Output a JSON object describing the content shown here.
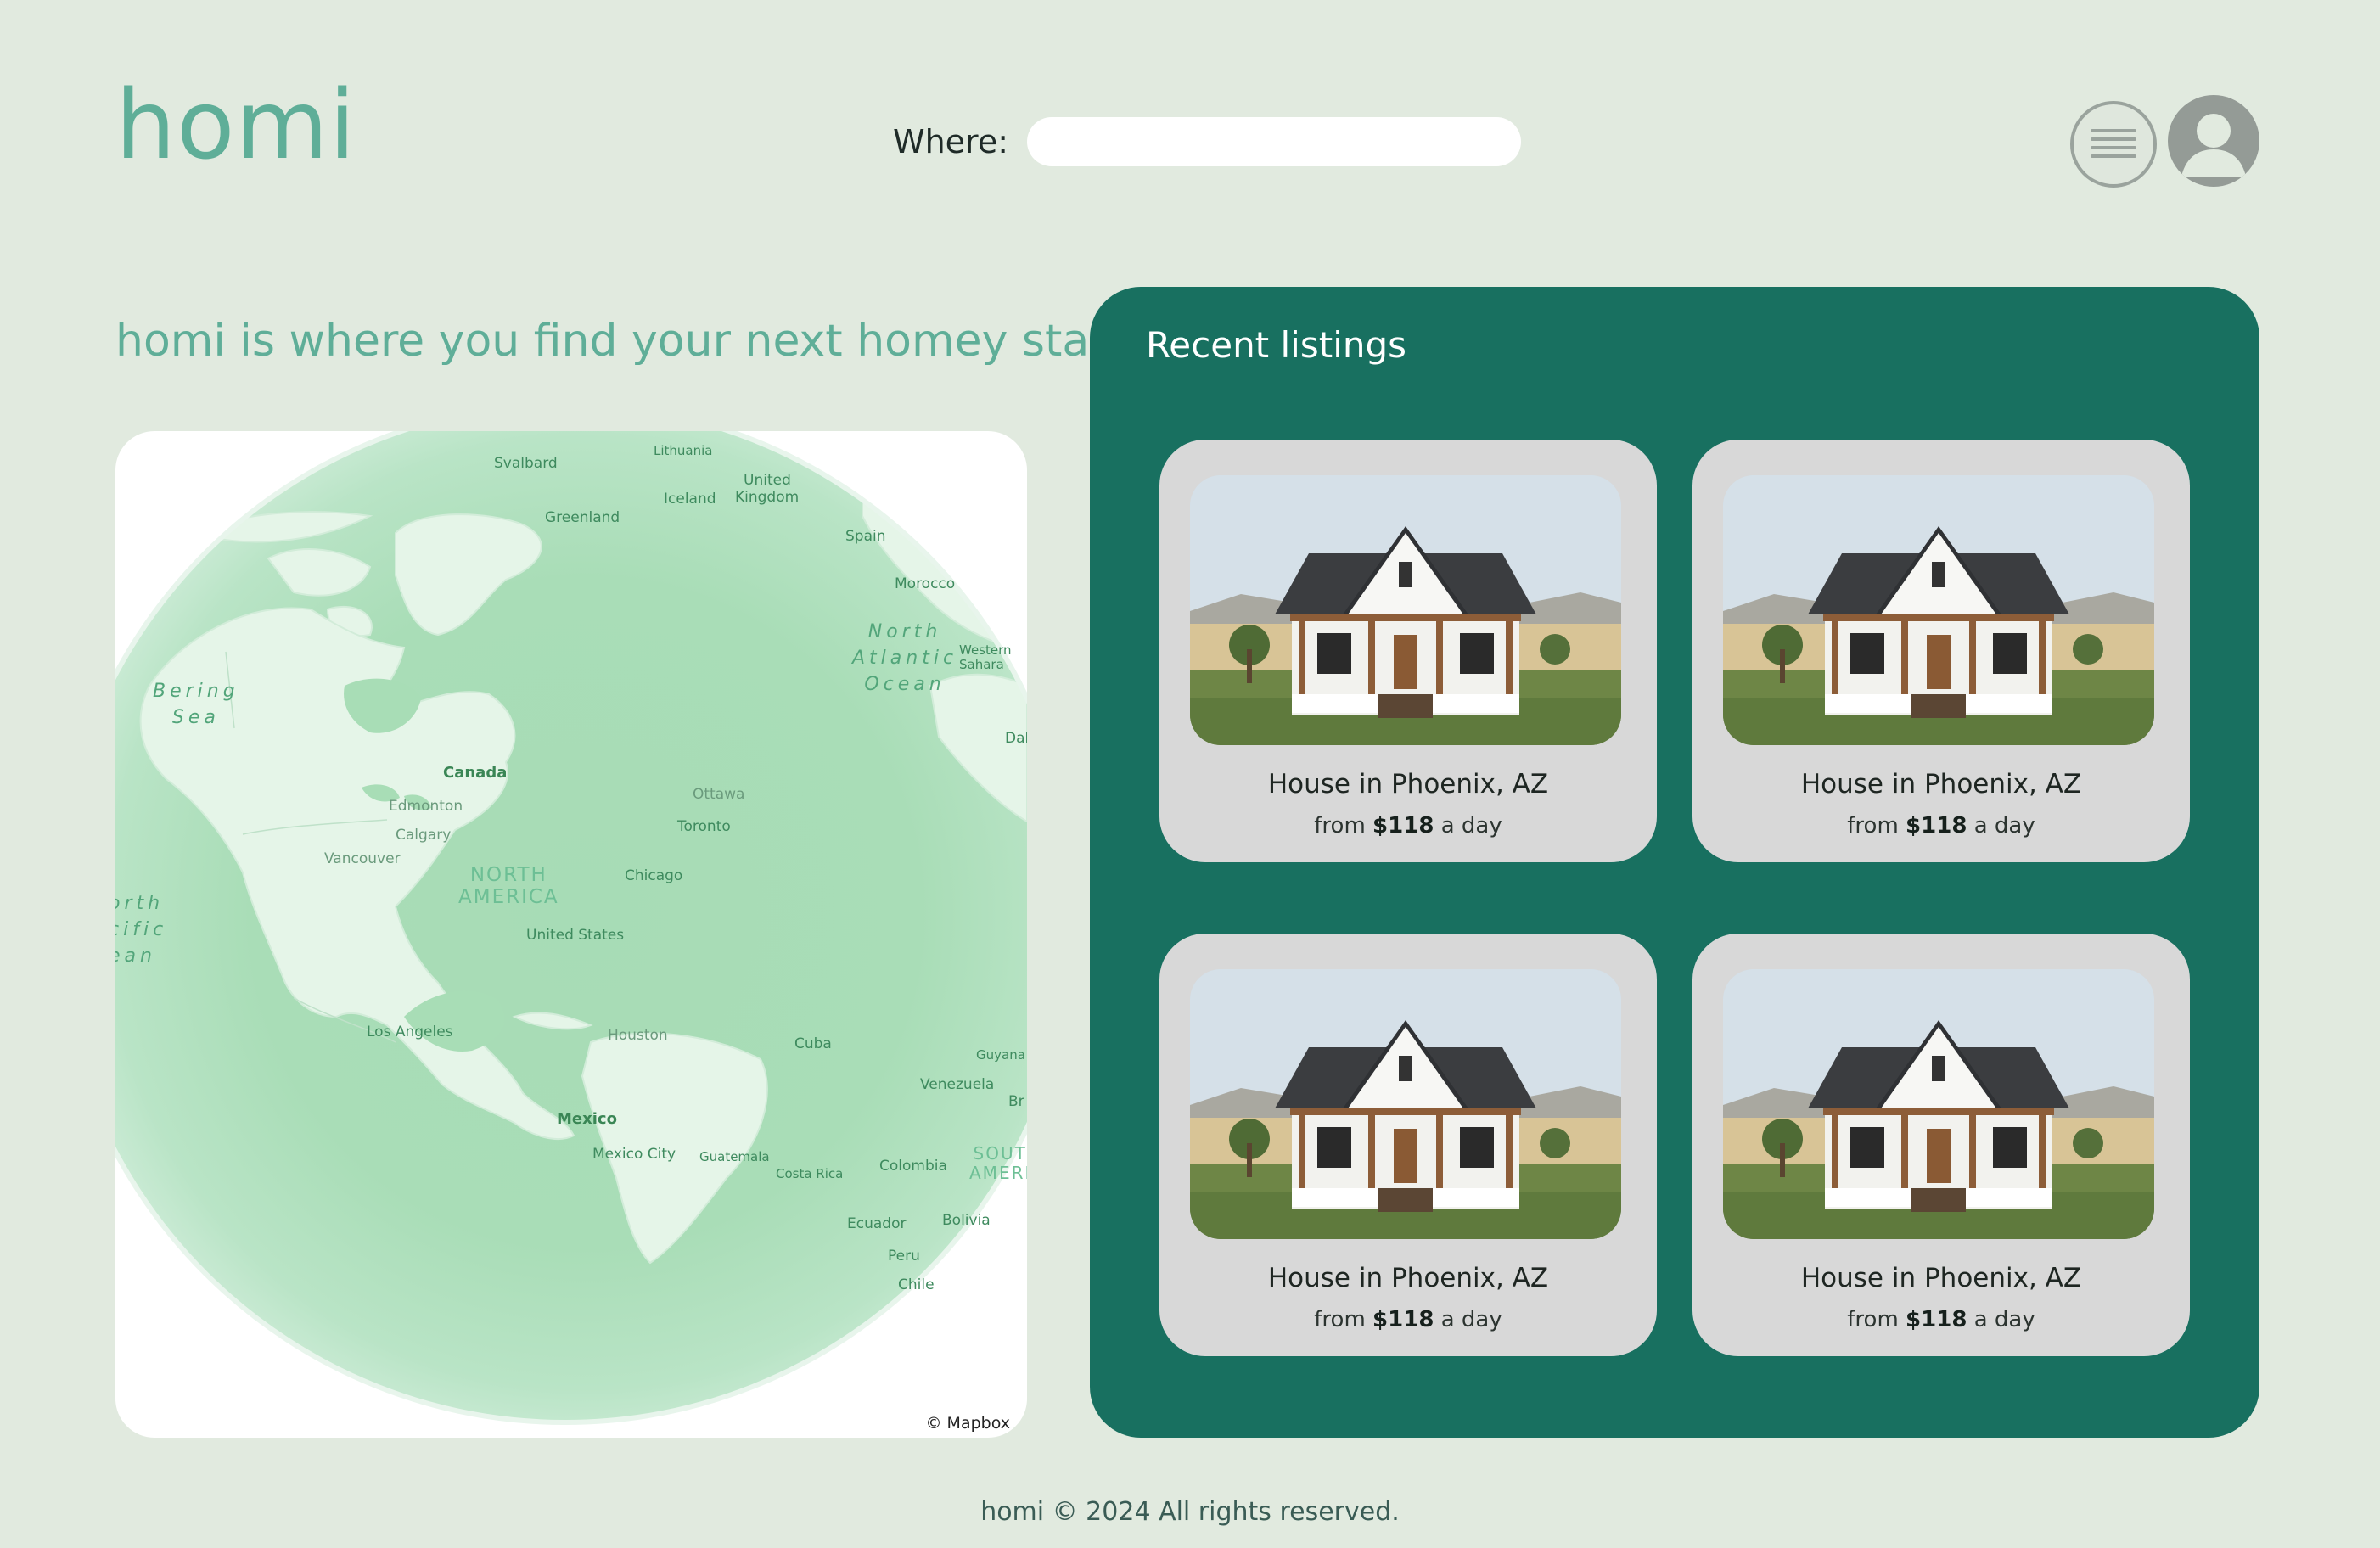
{
  "header": {
    "logo": "homi",
    "where_label": "Where:",
    "where_value": "",
    "menu_icon": "hamburger-menu-icon",
    "avatar_icon": "user-avatar-icon"
  },
  "hero": {
    "tagline": "homi is where you find your next homey stay"
  },
  "map": {
    "labels": {
      "svalbard": "Svalbard",
      "lithuania": "Lithuania",
      "united_kingdom_1": "United",
      "united_kingdom_2": "Kingdom",
      "iceland": "Iceland",
      "greenland": "Greenland",
      "spain": "Spain",
      "morocco": "Morocco",
      "north_atlantic_1": "North",
      "north_atlantic_2": "Atlantic",
      "north_atlantic_3": "Ocean",
      "western_sahara_1": "Western",
      "western_sahara_2": "Sahara",
      "bering_1": "Bering",
      "bering_2": "Sea",
      "dak": "Dak",
      "canada": "Canada",
      "edmonton": "Edmonton",
      "calgary": "Calgary",
      "vancouver": "Vancouver",
      "ottawa": "Ottawa",
      "toronto": "Toronto",
      "north_america_1": "NORTH",
      "north_america_2": "AMERICA",
      "chicago": "Chicago",
      "north_pacific_1": "orth",
      "north_pacific_2": "cific",
      "north_pacific_3": "ean",
      "united_states": "United States",
      "los_angeles": "Los Angeles",
      "houston": "Houston",
      "cuba": "Cuba",
      "guyana": "Guyana",
      "venezuela": "Venezuela",
      "br": "Br",
      "mexico": "Mexico",
      "mexico_city": "Mexico City",
      "guatemala": "Guatemala",
      "costa_rica": "Costa Rica",
      "colombia": "Colombia",
      "south_america_1": "SOUTH",
      "south_america_2": "AMERIC",
      "ecuador": "Ecuador",
      "bolivia": "Bolivia",
      "peru": "Peru",
      "chile": "Chile"
    },
    "attribution": "© Mapbox"
  },
  "listings": {
    "title": "Recent listings",
    "items": [
      {
        "title": "House in Phoenix, AZ",
        "price_prefix": "from",
        "price": "$118",
        "price_suffix": "a day"
      },
      {
        "title": "House in Phoenix, AZ",
        "price_prefix": "from",
        "price": "$118",
        "price_suffix": "a day"
      },
      {
        "title": "House in Phoenix, AZ",
        "price_prefix": "from",
        "price": "$118",
        "price_suffix": "a day"
      },
      {
        "title": "House in Phoenix, AZ",
        "price_prefix": "from",
        "price": "$118",
        "price_suffix": "a day"
      }
    ]
  },
  "footer": {
    "text": "homi © 2024 All rights reserved."
  },
  "colors": {
    "background": "#e1eadf",
    "brand": "#5fae98",
    "panel": "#187060",
    "card": "#d8d8d8",
    "map_land": "#a8ddb6"
  }
}
